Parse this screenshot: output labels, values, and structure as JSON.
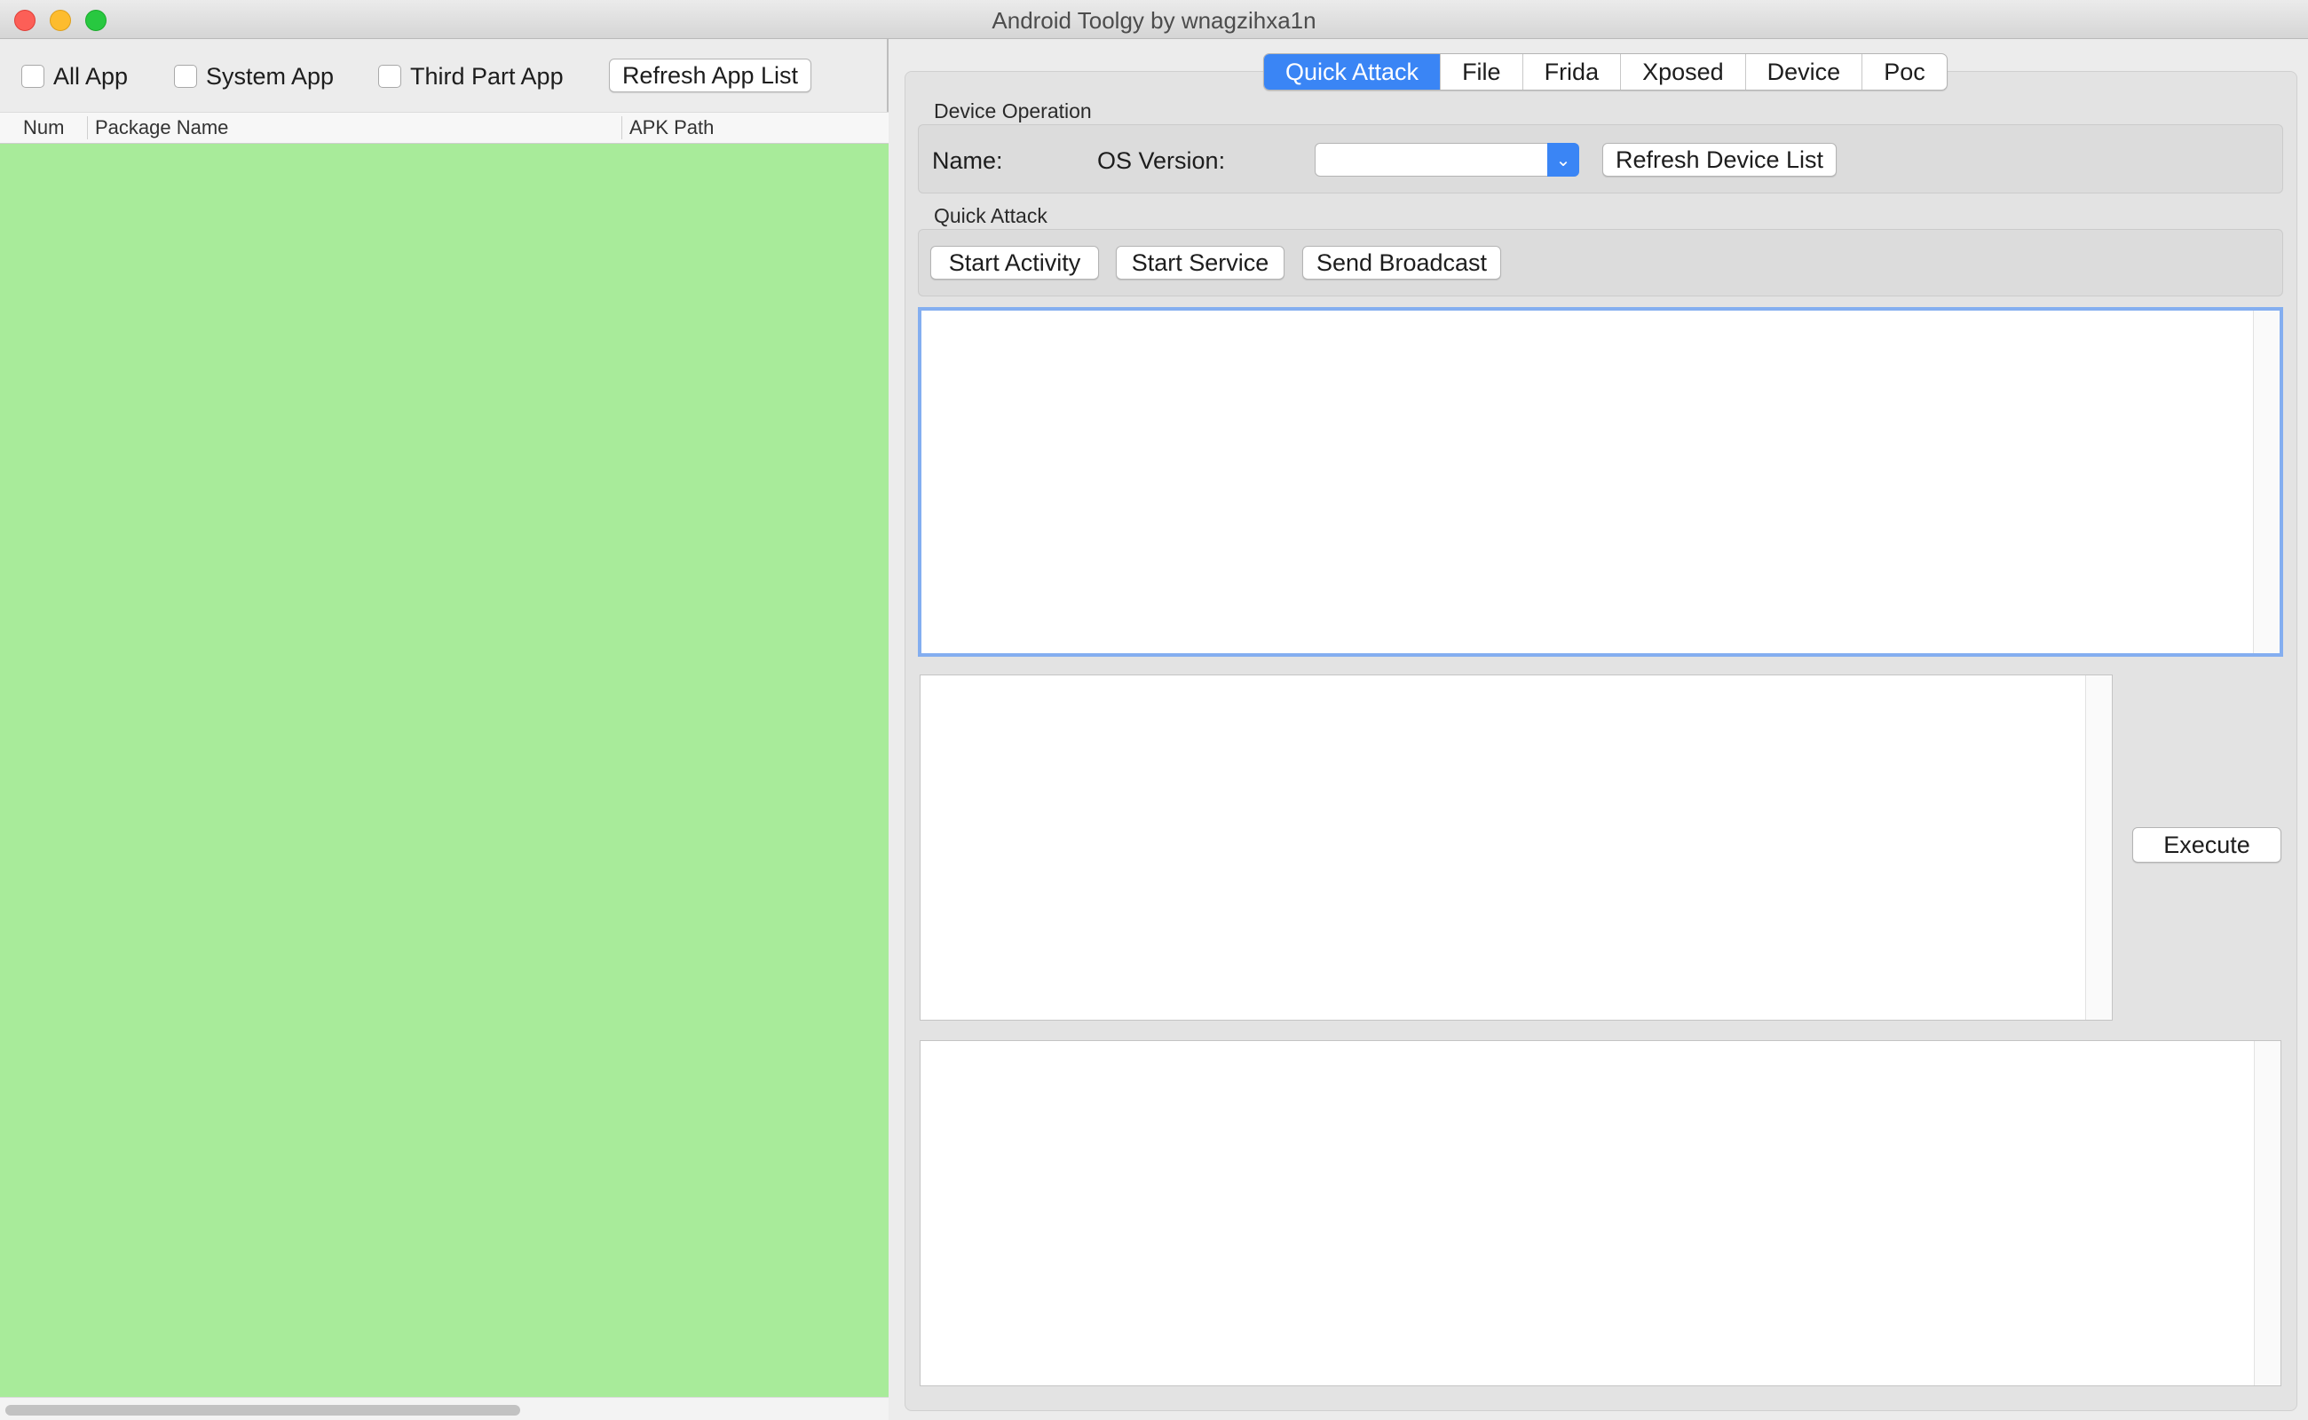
{
  "window": {
    "title": "Android Toolgy by wnagzihxa1n"
  },
  "app_list": {
    "filters": [
      {
        "label": "All App",
        "checked": false
      },
      {
        "label": "System App",
        "checked": false
      },
      {
        "label": "Third Part App",
        "checked": false
      }
    ],
    "refresh_label": "Refresh App List",
    "columns": [
      "Num",
      "Package Name",
      "APK Path"
    ],
    "rows": []
  },
  "tabs": [
    {
      "label": "Quick Attack",
      "active": true
    },
    {
      "label": "File",
      "active": false
    },
    {
      "label": "Frida",
      "active": false
    },
    {
      "label": "Xposed",
      "active": false
    },
    {
      "label": "Device",
      "active": false
    },
    {
      "label": "Poc",
      "active": false
    }
  ],
  "device_operation": {
    "group_label": "Device Operation",
    "name_label": "Name:",
    "os_version_label": "OS Version:",
    "device_select_value": "",
    "refresh_label": "Refresh Device List"
  },
  "quick_attack": {
    "group_label": "Quick Attack",
    "start_activity_label": "Start Activity",
    "start_service_label": "Start Service",
    "send_broadcast_label": "Send Broadcast"
  },
  "execute_label": "Execute",
  "colors": {
    "accent": "#3a85f5",
    "list_background": "#a8eb9a",
    "focus_ring": "#84aef0"
  }
}
